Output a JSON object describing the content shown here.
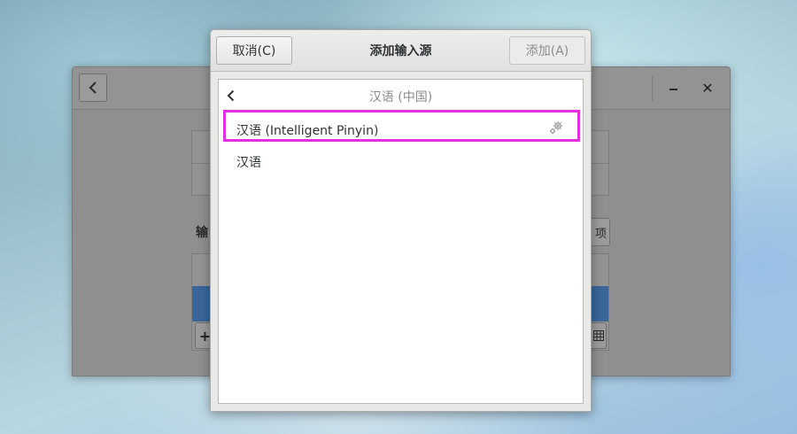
{
  "background_window": {
    "heading_fragment": "输",
    "right_button_fragment": "项",
    "add_fragment": "+"
  },
  "dialog": {
    "cancel_label": "取消(C)",
    "title": "添加输入源",
    "add_label": "添加(A)",
    "nav_title": "汉语 (中国)",
    "items": [
      {
        "label": "汉语 (Intelligent Pinyin)",
        "has_settings": true,
        "highlighted": true
      },
      {
        "label": "汉语",
        "has_settings": false,
        "highlighted": false
      }
    ]
  },
  "colors": {
    "highlight": "#e32fe0",
    "selected_row_bg": "#3a6698"
  }
}
